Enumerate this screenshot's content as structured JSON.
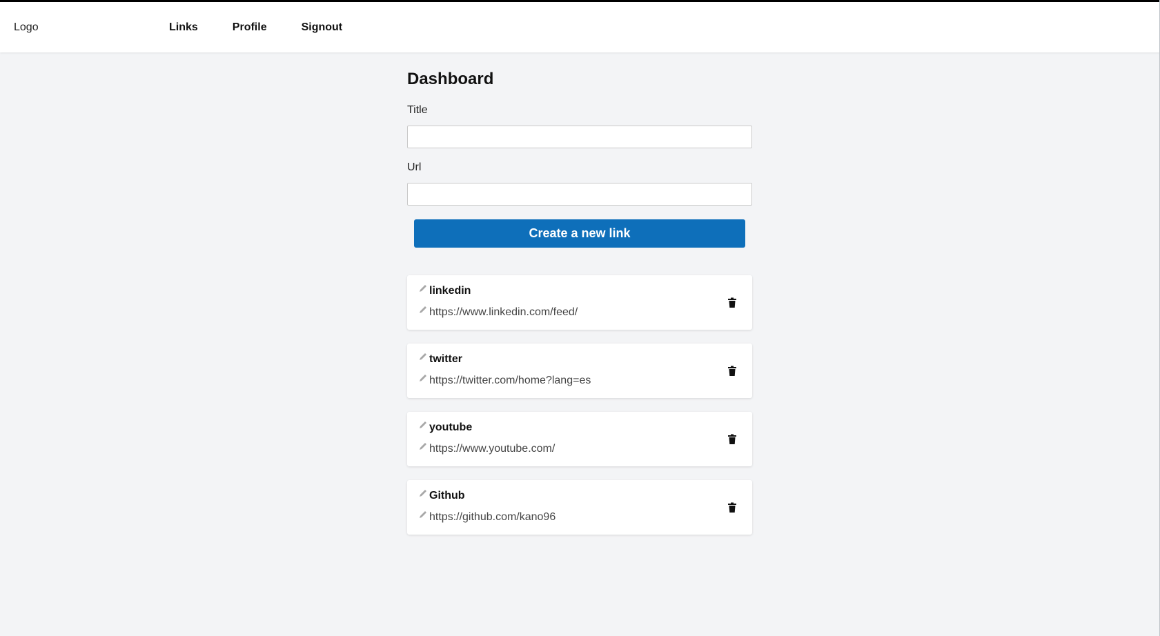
{
  "navbar": {
    "logo": "Logo",
    "items": [
      {
        "label": "Links"
      },
      {
        "label": "Profile"
      },
      {
        "label": "Signout"
      }
    ]
  },
  "dashboard": {
    "title": "Dashboard",
    "title_field": {
      "label": "Title",
      "value": "",
      "placeholder": ""
    },
    "url_field": {
      "label": "Url",
      "value": "",
      "placeholder": ""
    },
    "create_button": "Create a new link"
  },
  "links": [
    {
      "title": "linkedin",
      "url": "https://www.linkedin.com/feed/"
    },
    {
      "title": "twitter",
      "url": "https://twitter.com/home?lang=es"
    },
    {
      "title": "youtube",
      "url": "https://www.youtube.com/"
    },
    {
      "title": "Github",
      "url": "https://github.com/kano96"
    }
  ],
  "icons": {
    "edit": "pencil-icon",
    "delete": "trash-icon"
  },
  "colors": {
    "accent": "#0e6fba",
    "background": "#f3f4f6",
    "card": "#ffffff"
  }
}
